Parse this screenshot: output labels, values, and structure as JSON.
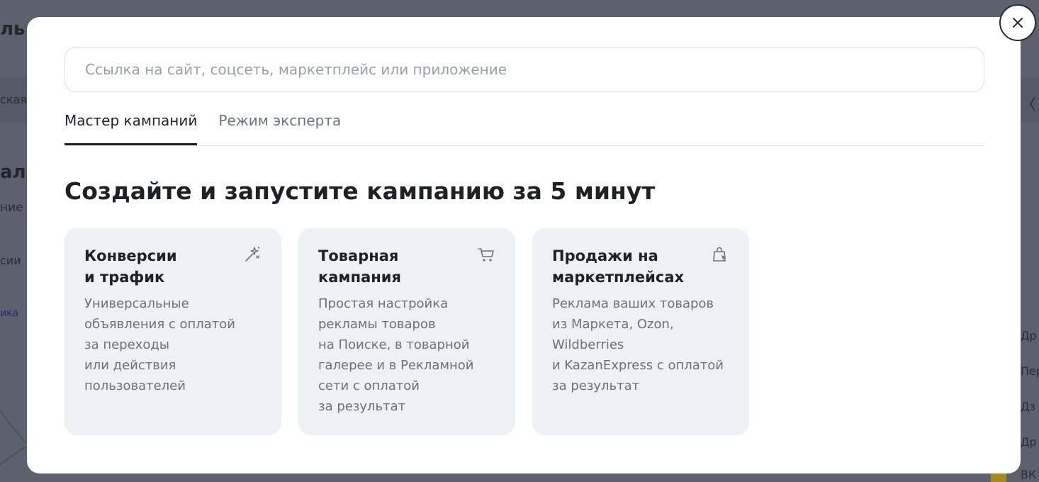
{
  "background": {
    "fragments": [
      "ль",
      "ская",
      "ал",
      "ние",
      "сии",
      "ика"
    ],
    "right_fragments": [
      "〈",
      "Др",
      "Пер",
      "Дз",
      "Др",
      "ВК"
    ]
  },
  "modal": {
    "search": {
      "placeholder": "Ссылка на сайт, соцсеть, маркетплейс или приложение",
      "value": ""
    },
    "tabs": [
      {
        "label": "Мастер кампаний",
        "active": true
      },
      {
        "label": "Режим эксперта",
        "active": false
      }
    ],
    "headline": "Создайте и запустите кампанию за 5 минут",
    "cards": [
      {
        "title": "Конверсии\nи трафик",
        "description": "Универсальные\nобъявления с оплатой\nза переходы\nили действия\nпользователей",
        "icon": "magic-wand-icon"
      },
      {
        "title": "Товарная\nкампания",
        "description": "Простая настройка\nрекламы товаров\nна Поиске, в товарной\nгалерее и в Рекламной\nсети с оплатой\nза результат",
        "icon": "cart-icon"
      },
      {
        "title": "Продажи на\nмаркетплейсах",
        "description": "Реклама ваших товаров\nиз Маркета, Ozon,\nWildberries\nи KazanExpress с оплатой\nза результат",
        "icon": "shopping-bag-icon"
      }
    ],
    "close_icon": "close-icon"
  },
  "colors": {
    "overlay": "#5d616d",
    "modal_bg": "#ffffff",
    "card_bg": "#eef0f5",
    "text_primary": "#1f2126",
    "text_secondary": "#6c707a"
  }
}
